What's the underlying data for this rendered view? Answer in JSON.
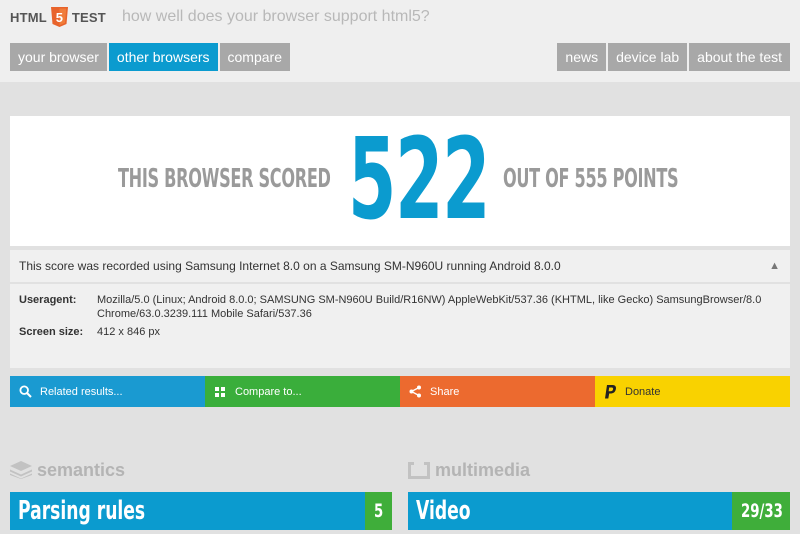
{
  "header": {
    "logo_left": "HTML",
    "logo_badge": "5",
    "logo_right": "TEST",
    "tagline": "how well does your browser support html5?"
  },
  "nav": {
    "left": [
      {
        "label": "your browser",
        "active": false
      },
      {
        "label": "other browsers",
        "active": true
      },
      {
        "label": "compare",
        "active": false
      }
    ],
    "right": [
      {
        "label": "news"
      },
      {
        "label": "device lab"
      },
      {
        "label": "about the test"
      }
    ]
  },
  "score": {
    "prefix": "THIS BROWSER SCORED",
    "value": "522",
    "suffix": "OUT OF 555 POINTS"
  },
  "recorded": {
    "text": "This score was recorded using Samsung Internet 8.0 on a Samsung SM-N960U running Android 8.0.0",
    "toggle_icon": "▲"
  },
  "details": {
    "useragent_label": "Useragent:",
    "useragent_value": "Mozilla/5.0 (Linux; Android 8.0.0; SAMSUNG SM-N960U Build/R16NW) AppleWebKit/537.36 (KHTML, like Gecko) SamsungBrowser/8.0 Chrome/63.0.3239.111 Mobile Safari/537.36",
    "screen_label": "Screen size:",
    "screen_value": "412 x 846 px"
  },
  "actions": [
    {
      "label": "Related results...",
      "icon": "search-icon",
      "color": "#1a9ad1"
    },
    {
      "label": "Compare to...",
      "icon": "grid-icon",
      "color": "#3aae3b"
    },
    {
      "label": "Share",
      "icon": "share-icon",
      "color": "#ec6a2f"
    },
    {
      "label": "Donate",
      "icon": "paypal-icon",
      "color": "#f9d200"
    }
  ],
  "sections": [
    {
      "title": "semantics",
      "icon": "stack-icon",
      "bar_label": "Parsing rules",
      "bar_score": "5"
    },
    {
      "title": "multimedia",
      "icon": "screen-icon",
      "bar_label": "Video",
      "bar_score": "29/33"
    }
  ],
  "colors": {
    "accent": "#0b9bcf",
    "score_green": "#3fae3a",
    "tab_inactive": "#a8a8a8"
  }
}
